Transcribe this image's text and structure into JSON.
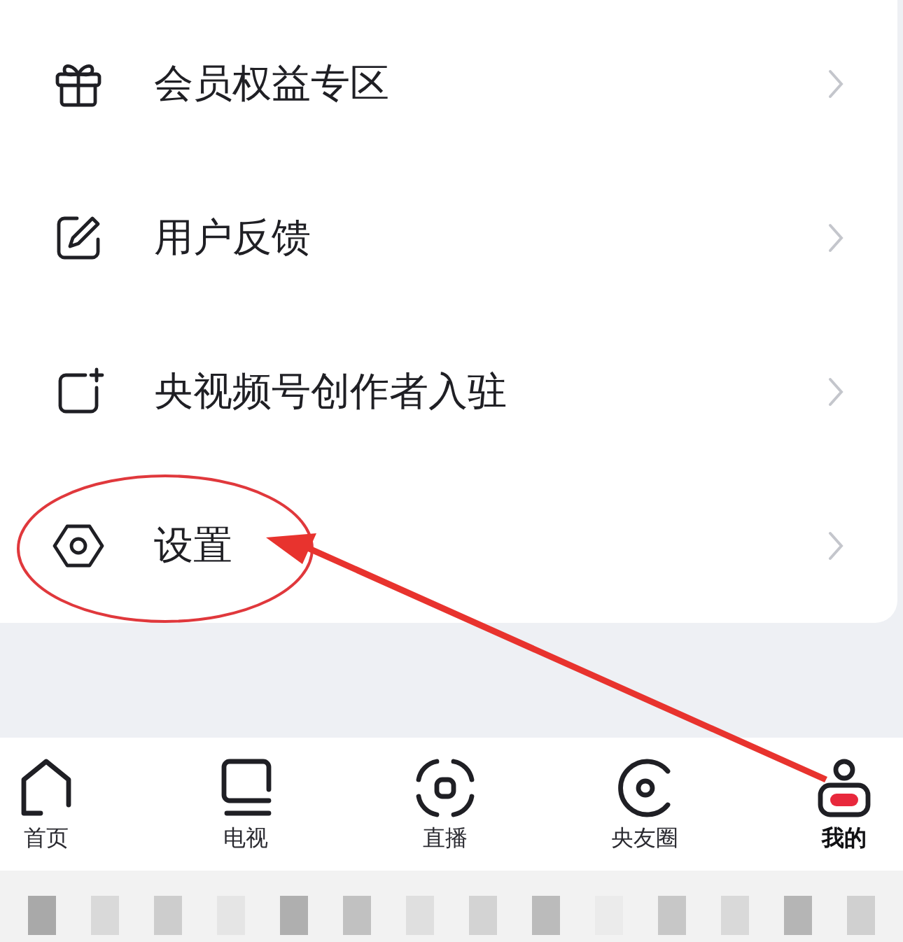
{
  "menu": [
    {
      "label": "会员权益专区"
    },
    {
      "label": "用户反馈"
    },
    {
      "label": "央视频号创作者入驻"
    },
    {
      "label": "设置"
    }
  ],
  "tab_bar": [
    {
      "label": "首页",
      "selected": false
    },
    {
      "label": "电视",
      "selected": false
    },
    {
      "label": "直播",
      "selected": false
    },
    {
      "label": "央友圈",
      "selected": false
    },
    {
      "label": "我的",
      "selected": true
    }
  ]
}
